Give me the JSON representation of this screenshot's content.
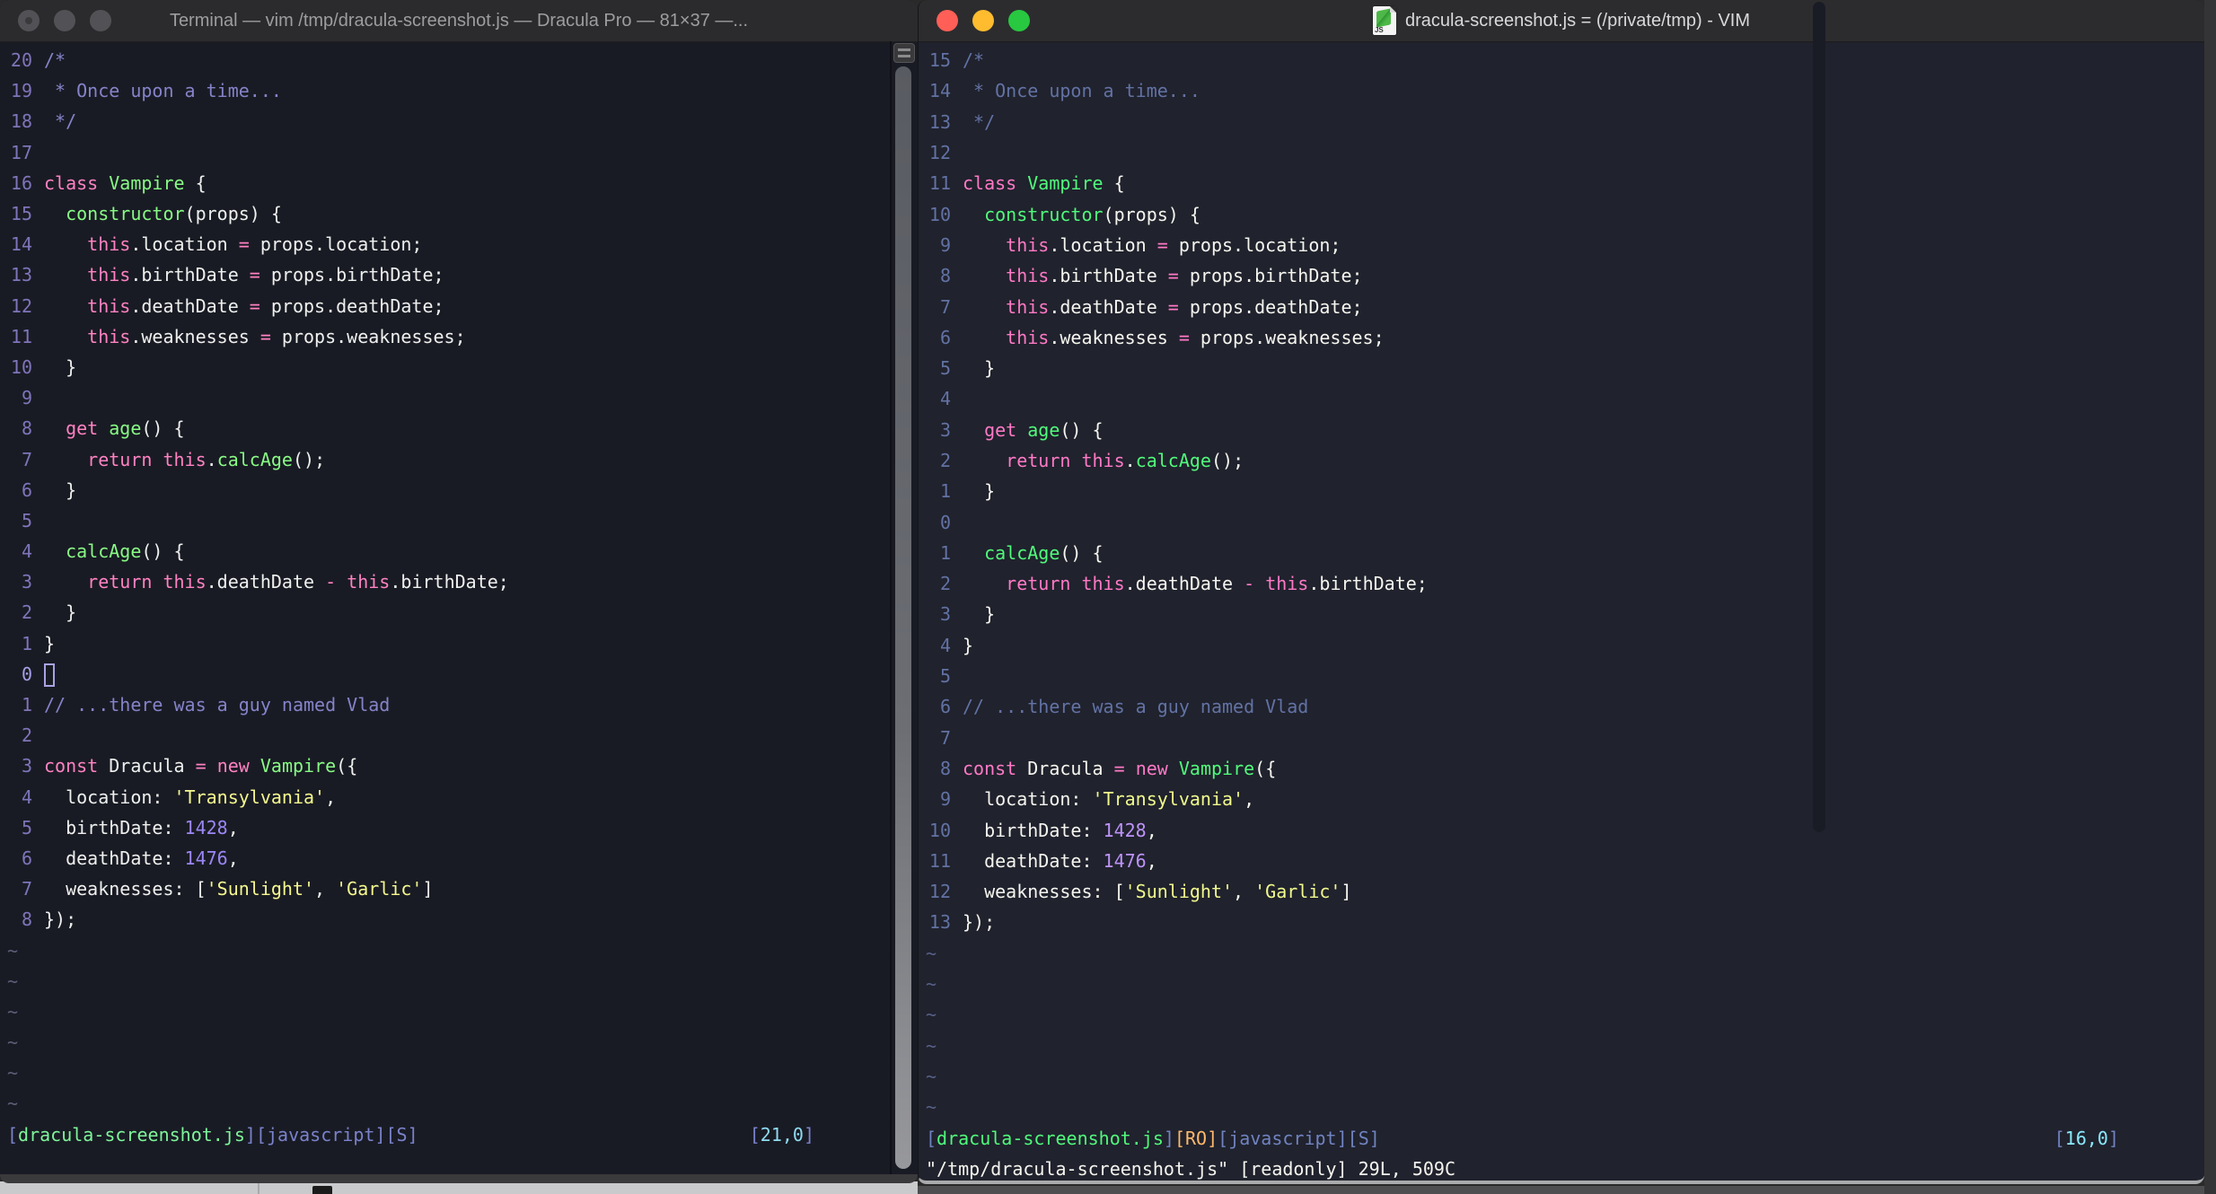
{
  "left_window": {
    "titlebar": {
      "title": "Terminal — vim /tmp/dracula-screenshot.js — Dracula Pro — 81×37 —..."
    },
    "line_numbers": [
      "20",
      "19",
      "18",
      "17",
      "16",
      "15",
      "14",
      "13",
      "12",
      "11",
      "10",
      "9",
      "8",
      "7",
      "6",
      "5",
      "4",
      "3",
      "2",
      "1",
      "0",
      "1",
      "2",
      "3",
      "4",
      "5",
      "6",
      "7",
      "8"
    ],
    "cursor_row": 20,
    "cursor": "hollow",
    "tilde_count": 6,
    "statusline": {
      "left": [
        [
          "sb",
          "["
        ],
        [
          "sg",
          "dracula-screenshot.js"
        ],
        [
          "sb",
          "]["
        ],
        [
          "si",
          "javascript"
        ],
        [
          "sb",
          "]["
        ],
        [
          "si",
          "S"
        ],
        [
          "sb",
          "]"
        ]
      ],
      "right": [
        [
          "sb",
          "["
        ],
        [
          "sc",
          "21,0"
        ],
        [
          "sb",
          "]"
        ]
      ]
    },
    "cmdline": ""
  },
  "right_window": {
    "titlebar": {
      "title": "dracula-screenshot.js = (/private/tmp) - VIM",
      "icon_label": "JS"
    },
    "line_numbers": [
      "15",
      "14",
      "13",
      "12",
      "11",
      "10",
      "9",
      "8",
      "7",
      "6",
      "5",
      "4",
      "3",
      "2",
      "1",
      "0",
      "1",
      "2",
      "3",
      "4",
      "5",
      "6",
      "7",
      "8",
      "9",
      "10",
      "11",
      "12",
      "13"
    ],
    "cursor_row": 15,
    "cursor": "none",
    "tilde_count": 6,
    "statusline": {
      "left": [
        [
          "sb",
          "["
        ],
        [
          "sg",
          "dracula-screenshot.js"
        ],
        [
          "sb",
          "]"
        ],
        [
          "so",
          "[RO]"
        ],
        [
          "sb",
          "["
        ],
        [
          "si",
          "javascript"
        ],
        [
          "sb",
          "]["
        ],
        [
          "si",
          "S"
        ],
        [
          "sb",
          "]"
        ]
      ],
      "right": [
        [
          "sb",
          "["
        ],
        [
          "sc",
          "16,0"
        ],
        [
          "sb",
          "]"
        ]
      ]
    },
    "cmdline": "\"/tmp/dracula-screenshot.js\" [readonly] 29L, 509C"
  },
  "vim": {
    "tilde_char": "~"
  },
  "code_lines": [
    [
      [
        "cm",
        "/*"
      ]
    ],
    [
      [
        "cm",
        " * Once upon a time..."
      ]
    ],
    [
      [
        "cm",
        " */"
      ]
    ],
    [],
    [
      [
        "pk",
        "class"
      ],
      [
        "fg",
        " "
      ],
      [
        "gr",
        "Vampire"
      ],
      [
        "fg",
        " {"
      ]
    ],
    [
      [
        "fg",
        "  "
      ],
      [
        "gr",
        "constructor"
      ],
      [
        "fg",
        "(props) {"
      ]
    ],
    [
      [
        "fg",
        "    "
      ],
      [
        "pk",
        "this"
      ],
      [
        "fg",
        ".location "
      ],
      [
        "pk",
        "="
      ],
      [
        "fg",
        " props.location;"
      ]
    ],
    [
      [
        "fg",
        "    "
      ],
      [
        "pk",
        "this"
      ],
      [
        "fg",
        ".birthDate "
      ],
      [
        "pk",
        "="
      ],
      [
        "fg",
        " props.birthDate;"
      ]
    ],
    [
      [
        "fg",
        "    "
      ],
      [
        "pk",
        "this"
      ],
      [
        "fg",
        ".deathDate "
      ],
      [
        "pk",
        "="
      ],
      [
        "fg",
        " props.deathDate;"
      ]
    ],
    [
      [
        "fg",
        "    "
      ],
      [
        "pk",
        "this"
      ],
      [
        "fg",
        ".weaknesses "
      ],
      [
        "pk",
        "="
      ],
      [
        "fg",
        " props.weaknesses;"
      ]
    ],
    [
      [
        "fg",
        "  }"
      ]
    ],
    [],
    [
      [
        "fg",
        "  "
      ],
      [
        "pk",
        "get"
      ],
      [
        "fg",
        " "
      ],
      [
        "gr",
        "age"
      ],
      [
        "fg",
        "() {"
      ]
    ],
    [
      [
        "fg",
        "    "
      ],
      [
        "pk",
        "return"
      ],
      [
        "fg",
        " "
      ],
      [
        "pk",
        "this"
      ],
      [
        "fg",
        "."
      ],
      [
        "gr",
        "calcAge"
      ],
      [
        "fg",
        "();"
      ]
    ],
    [
      [
        "fg",
        "  }"
      ]
    ],
    [],
    [
      [
        "fg",
        "  "
      ],
      [
        "gr",
        "calcAge"
      ],
      [
        "fg",
        "() {"
      ]
    ],
    [
      [
        "fg",
        "    "
      ],
      [
        "pk",
        "return"
      ],
      [
        "fg",
        " "
      ],
      [
        "pk",
        "this"
      ],
      [
        "fg",
        ".deathDate "
      ],
      [
        "pk",
        "-"
      ],
      [
        "fg",
        " "
      ],
      [
        "pk",
        "this"
      ],
      [
        "fg",
        ".birthDate;"
      ]
    ],
    [
      [
        "fg",
        "  }"
      ]
    ],
    [
      [
        "fg",
        "}"
      ]
    ],
    [],
    [
      [
        "cm",
        "// ...there was a guy named Vlad"
      ]
    ],
    [],
    [
      [
        "pk",
        "const"
      ],
      [
        "fg",
        " Dracula "
      ],
      [
        "pk",
        "="
      ],
      [
        "fg",
        " "
      ],
      [
        "pk",
        "new"
      ],
      [
        "fg",
        " "
      ],
      [
        "gr",
        "Vampire"
      ],
      [
        "fg",
        "({"
      ]
    ],
    [
      [
        "fg",
        "  location: "
      ],
      [
        "yl",
        "'Transylvania'"
      ],
      [
        "fg",
        ","
      ]
    ],
    [
      [
        "fg",
        "  birthDate: "
      ],
      [
        "pu",
        "1428"
      ],
      [
        "fg",
        ","
      ]
    ],
    [
      [
        "fg",
        "  deathDate: "
      ],
      [
        "pu",
        "1476"
      ],
      [
        "fg",
        ","
      ]
    ],
    [
      [
        "fg",
        "  weaknesses: ["
      ],
      [
        "yl",
        "'Sunlight'"
      ],
      [
        "fg",
        ", "
      ],
      [
        "yl",
        "'Garlic'"
      ],
      [
        "fg",
        "]"
      ]
    ],
    [
      [
        "fg",
        "});"
      ]
    ]
  ],
  "colors": {
    "left_theme": {
      "bg": "#191b24",
      "comment": "#8583c9",
      "pink": "#ff82c2",
      "green": "#88fb85",
      "fg": "#eef0ee",
      "yellow": "#f5f88e",
      "purple": "#9b87f5",
      "line_number": "#7e75ba",
      "cyan": "#8fdcf2"
    },
    "right_theme": {
      "bg": "#20222d",
      "comment": "#6272a4",
      "pink": "#ff79c6",
      "green": "#50fa7b",
      "fg": "#f5f5ef",
      "yellow": "#f1fa8c",
      "purple": "#bd93f9",
      "line_number": "#6272a4",
      "cyan": "#8be9fd",
      "orange": "#ffb86c"
    },
    "traffic_lights": {
      "close": "#ff5f57",
      "minimize": "#febc2e",
      "zoom": "#28c840",
      "inactive": "#525256"
    }
  }
}
